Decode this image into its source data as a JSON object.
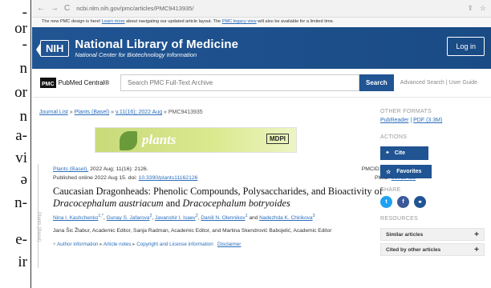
{
  "left_fragments": [
    "-",
    "or",
    "-",
    "n",
    "or",
    "n",
    "a-",
    "vi",
    "ə",
    "n-",
    "e-",
    "ir"
  ],
  "browser": {
    "url": "ncbi.nlm.nih.gov/pmc/articles/PMC9413935/"
  },
  "banner": {
    "text_before": "The new PMC design is here! ",
    "learn_more": "Learn more",
    "text_middle": " about navigating our updated article layout. The ",
    "legacy_link": "PMC legacy view",
    "text_after": " will also be available for a limited time."
  },
  "header": {
    "logo": "NIH",
    "title": "National Library of Medicine",
    "subtitle": "National Center for Biotechnology Information",
    "login": "Log in"
  },
  "search": {
    "logo_box": "PMC",
    "logo_text": "PubMed Central®",
    "placeholder": "Search PMC Full-Text Archive",
    "button": "Search",
    "advanced": "Advanced Search",
    "divider": " | ",
    "guide": "User Guide"
  },
  "breadcrumb": {
    "journal_list": "Journal List",
    "journal": "Plants (Basel)",
    "volume": "v.11(16); 2022 Aug",
    "article": "PMC9413935",
    "sep": " » "
  },
  "journal_banner": {
    "name": "plants",
    "publisher": "MDPI"
  },
  "side_tab": "Plants (Basel)",
  "citation": {
    "journal": "Plants (Basel).",
    "details": " 2022 Aug; 11(16): 2126.",
    "published": "Published online 2022 Aug 15. doi: ",
    "doi": "10.3390/plants11162126",
    "pmcid": "PMCID: PMC9413935",
    "pmid_label": "PMID: ",
    "pmid": "36015428"
  },
  "article": {
    "title_line1": "Caucasian Dragonheads: Phenolic Compounds, Polysaccharides, and Bioactivity of",
    "title_species1": "Dracocephalum austriacum",
    "title_and": " and ",
    "title_species2": "Dracocephalum botryoides",
    "authors": [
      {
        "name": "Nina I. Kashchenko",
        "sup": "1,*"
      },
      {
        "name": "Gunay S. Jafarova",
        "sup": "2"
      },
      {
        "name": "Javanshir I. Isaev",
        "sup": "2"
      },
      {
        "name": "Daniil N. Olennikov",
        "sup": "1"
      },
      {
        "name": "Nadezhda K. Chirikova",
        "sup": "3"
      }
    ],
    "and_text": "and",
    "editors": "Jana Šic Žlabur, Academic Editor, Sanja Radman, Academic Editor, and Martina Skendrović Babojelić, Academic Editor",
    "info_author": "Author information",
    "info_notes": "Article notes",
    "info_copyright": "Copyright and License information",
    "info_disclaimer": "Disclaimer"
  },
  "sidebar": {
    "other_formats": "OTHER FORMATS",
    "pubreader": "PubReader",
    "pdf": "PDF (3.3M)",
    "actions": "ACTIONS",
    "cite": "Cite",
    "favorites": "Favorites",
    "share": "SHARE",
    "resources": "RESOURCES",
    "similar": "Similar articles",
    "cited_by": "Cited by other articles"
  },
  "colors": {
    "nlm_blue": "#205493",
    "link_blue": "#2a6ebb",
    "twitter": "#1da1f2",
    "facebook": "#3b5998",
    "link_share": "#205493"
  }
}
